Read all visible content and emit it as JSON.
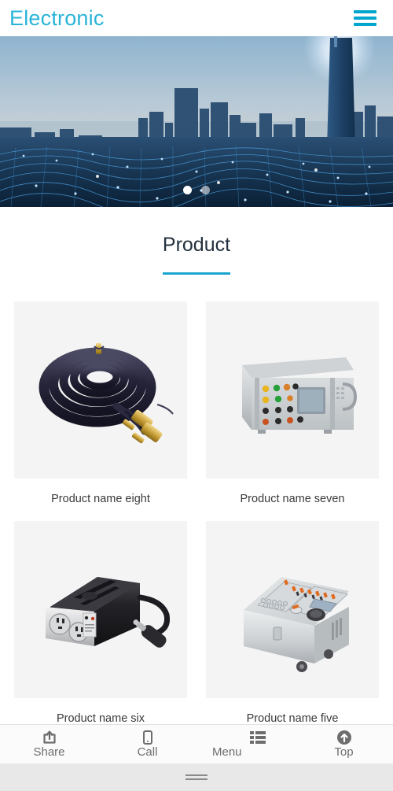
{
  "header": {
    "brand": "Electronic",
    "brand_color": "#29b4d8",
    "menu_icon": "hamburger-icon"
  },
  "hero": {
    "description": "City skyline at dusk with blue digital network mesh overlay",
    "carousel": {
      "total": 2,
      "active_index": 0
    }
  },
  "section": {
    "title": "Product",
    "rule_color": "#1ba5ce"
  },
  "products": [
    {
      "label": "Product name eight",
      "image": "coiled-black-audio-cable-with-gold-rca-connectors"
    },
    {
      "label": "Product name seven",
      "image": "gray-rack-test-instrument-with-colored-terminals-and-lcd"
    },
    {
      "label": "Product name six",
      "image": "black-car-power-inverter-with-sockets-and-plug"
    },
    {
      "label": "Product name five",
      "image": "gray-mobile-test-bench-with-control-panel-and-wheels"
    }
  ],
  "toolbar": [
    {
      "label": "Share",
      "icon": "share-icon"
    },
    {
      "label": "Call",
      "icon": "phone-icon"
    },
    {
      "label": "Menu",
      "icon": "list-icon"
    },
    {
      "label": "Top",
      "icon": "arrow-up-circle-icon"
    }
  ]
}
